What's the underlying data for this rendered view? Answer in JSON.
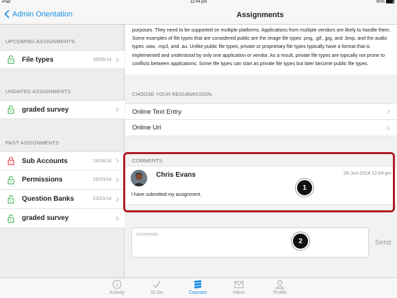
{
  "statusbar": {
    "device": "iPad",
    "time": "12:04 pm",
    "battery": "90%"
  },
  "nav": {
    "back_label": "Admin Orientation",
    "title": "Assignments"
  },
  "sidebar": {
    "upcoming_header": "UPCOMING ASSIGNMENTS",
    "upcoming": [
      {
        "name": "File types",
        "date": "30/06/14",
        "lock_color": "#3cb44b"
      }
    ],
    "undated_header": "UNDATED ASSIGNMENTS",
    "undated": [
      {
        "name": "graded survey",
        "date": "",
        "lock_color": "#3cb44b"
      }
    ],
    "past_header": "PAST ASSIGNMENTS",
    "past": [
      {
        "name": "Sub Accounts",
        "date": "24/04/14",
        "lock_color": "#e0343b"
      },
      {
        "name": "Permissions",
        "date": "26/03/14",
        "lock_color": "#3cb44b"
      },
      {
        "name": "Question Banks",
        "date": "23/03/14",
        "lock_color": "#3cb44b"
      },
      {
        "name": "graded survey",
        "date": "",
        "lock_color": "#3cb44b"
      }
    ]
  },
  "main": {
    "description": "purposes. They need to be supported on multiple platforms. Applications from multiple vendors are likely to handle them. Some examples of file types that are considered public are the image file types .png, .gif, .jpg, and .bmp, and the audio types .wav, .mp3, and .au. Unlike public file types, private or proprietary file types typically have a format that is implemented and understood by only one application or vendor. As a result, private file types are typically not prone to conflicts between applications. Some file types can start as private file types but later become public file types.",
    "resubmission_header": "CHOOSE YOUR RESUBMISSION:",
    "resubmission_options": [
      "Online Text Entry",
      "Online Url"
    ],
    "comments_header": "COMMENTS:",
    "comment": {
      "author": "Chris Evans",
      "timestamp": "28-Jun-2014 12:04 pm",
      "text": "I have submitted my assignment."
    },
    "comment_input_placeholder": "comments",
    "send_label": "Send",
    "callouts": [
      "1",
      "2"
    ]
  },
  "tabbar": {
    "tabs": [
      {
        "label": "Activity",
        "icon": "info-icon"
      },
      {
        "label": "To Do",
        "icon": "checkmark-icon"
      },
      {
        "label": "Courses",
        "icon": "courses-icon",
        "active": true
      },
      {
        "label": "Inbox",
        "icon": "inbox-icon"
      },
      {
        "label": "Profile",
        "icon": "profile-icon"
      }
    ]
  },
  "colors": {
    "accent": "#1a8fe6",
    "highlight": "#b01a22",
    "lock_open": "#3cb44b",
    "lock_red": "#e0343b"
  }
}
